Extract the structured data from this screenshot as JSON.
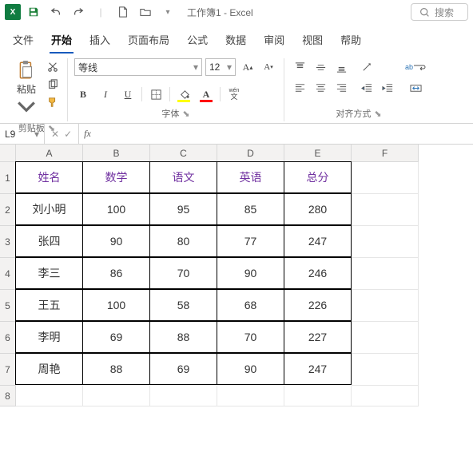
{
  "app": {
    "title": "工作簿1 - Excel",
    "logo_text": "X",
    "search_placeholder": "搜索"
  },
  "tabs": {
    "items": [
      "文件",
      "开始",
      "插入",
      "页面布局",
      "公式",
      "数据",
      "审阅",
      "视图",
      "帮助"
    ],
    "active": 1
  },
  "ribbon": {
    "clipboard": {
      "paste": "粘贴",
      "label": "剪贴板"
    },
    "font": {
      "name": "等线",
      "size": "12",
      "label": "字体"
    },
    "align": {
      "wrap": "ab",
      "label": "对齐方式"
    }
  },
  "formula": {
    "name": "L9",
    "fx": "fx",
    "value": ""
  },
  "grid": {
    "columns": [
      "A",
      "B",
      "C",
      "D",
      "E",
      "F"
    ],
    "rows": [
      "1",
      "2",
      "3",
      "4",
      "5",
      "6",
      "7",
      "8"
    ],
    "headers": [
      "姓名",
      "数学",
      "语文",
      "英语",
      "总分"
    ],
    "data": [
      [
        "刘小明",
        "100",
        "95",
        "85",
        "280"
      ],
      [
        "张四",
        "90",
        "80",
        "77",
        "247"
      ],
      [
        "李三",
        "86",
        "70",
        "90",
        "246"
      ],
      [
        "王五",
        "100",
        "58",
        "68",
        "226"
      ],
      [
        "李明",
        "69",
        "88",
        "70",
        "227"
      ],
      [
        "周艳",
        "88",
        "69",
        "90",
        "247"
      ]
    ]
  },
  "chart_data": {
    "type": "table",
    "columns": [
      "姓名",
      "数学",
      "语文",
      "英语",
      "总分"
    ],
    "rows": [
      {
        "姓名": "刘小明",
        "数学": 100,
        "语文": 95,
        "英语": 85,
        "总分": 280
      },
      {
        "姓名": "张四",
        "数学": 90,
        "语文": 80,
        "英语": 77,
        "总分": 247
      },
      {
        "姓名": "李三",
        "数学": 86,
        "语文": 70,
        "英语": 90,
        "总分": 246
      },
      {
        "姓名": "王五",
        "数学": 100,
        "语文": 58,
        "英语": 68,
        "总分": 226
      },
      {
        "姓名": "李明",
        "数学": 69,
        "语文": 88,
        "英语": 70,
        "总分": 227
      },
      {
        "姓名": "周艳",
        "数学": 88,
        "语文": 69,
        "英语": 90,
        "总分": 247
      }
    ]
  }
}
